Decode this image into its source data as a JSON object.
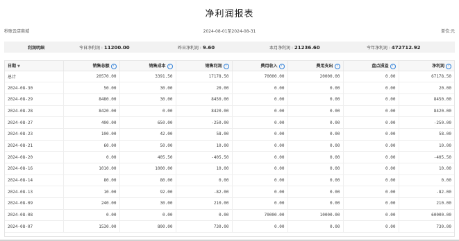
{
  "title": "净利润报表",
  "store_name": "秒账云店商城",
  "period": "2024-08-01至2024-08-31",
  "unit": "单位:元",
  "summary": {
    "label": "利润明细",
    "today_label": "今日净利润 : ",
    "today_value": "11200.00",
    "yesterday_label": "昨日净利润 : ",
    "yesterday_value": "9.60",
    "month_label": "本月净利润 : ",
    "month_value": "21236.60",
    "year_label": "今年净利润 : ",
    "year_value": "472712.92"
  },
  "table": {
    "headers": {
      "date": "日期",
      "sales_total": "销售总额",
      "sales_cost": "销售成本",
      "sales_profit": "销售利润",
      "fee_income": "费用收入",
      "fee_expense": "费用支出",
      "inventory_loss": "盘点损溢",
      "net_profit": "净利润"
    },
    "rows": [
      [
        "总计",
        "20570.00",
        "3391.50",
        "17178.50",
        "70000.00",
        "20000.00",
        "0.00",
        "67178.50"
      ],
      [
        "2024-08-30",
        "50.00",
        "30.00",
        "20.00",
        "0.00",
        "0.00",
        "0.00",
        "20.00"
      ],
      [
        "2024-08-29",
        "8480.00",
        "30.00",
        "8450.00",
        "0.00",
        "0.00",
        "0.00",
        "8450.00"
      ],
      [
        "2024-08-28",
        "8420.00",
        "0.00",
        "8420.00",
        "0.00",
        "0.00",
        "0.00",
        "8420.00"
      ],
      [
        "2024-08-27",
        "400.00",
        "650.00",
        "-250.00",
        "0.00",
        "0.00",
        "0.00",
        "-250.00"
      ],
      [
        "2024-08-23",
        "100.00",
        "42.00",
        "58.00",
        "0.00",
        "0.00",
        "0.00",
        "58.00"
      ],
      [
        "2024-08-21",
        "60.00",
        "50.00",
        "10.00",
        "0.00",
        "0.00",
        "0.00",
        "10.00"
      ],
      [
        "2024-08-20",
        "0.00",
        "405.50",
        "-405.50",
        "0.00",
        "0.00",
        "0.00",
        "-405.50"
      ],
      [
        "2024-08-16",
        "1010.00",
        "1000.00",
        "10.00",
        "0.00",
        "0.00",
        "0.00",
        "10.00"
      ],
      [
        "2024-08-14",
        "80.00",
        "80.00",
        "0.00",
        "0.00",
        "0.00",
        "0.00",
        "0.00"
      ],
      [
        "2024-08-13",
        "10.00",
        "92.00",
        "-82.00",
        "0.00",
        "0.00",
        "0.00",
        "-82.00"
      ],
      [
        "2024-08-09",
        "240.00",
        "30.00",
        "210.00",
        "0.00",
        "0.00",
        "0.00",
        "210.00"
      ],
      [
        "2024-08-08",
        "0.00",
        "0.00",
        "0.00",
        "70000.00",
        "10000.00",
        "0.00",
        "60000.00"
      ],
      [
        "2024-08-07",
        "1530.00",
        "800.00",
        "730.00",
        "0.00",
        "0.00",
        "0.00",
        "730.00"
      ]
    ]
  },
  "icons": {
    "help": "question-circle-icon",
    "sort": "caret-down-icon"
  },
  "colors": {
    "accent": "#2f7fd8",
    "summary_bg": "#f2f2f2",
    "header_bg": "#f7f7f7"
  }
}
